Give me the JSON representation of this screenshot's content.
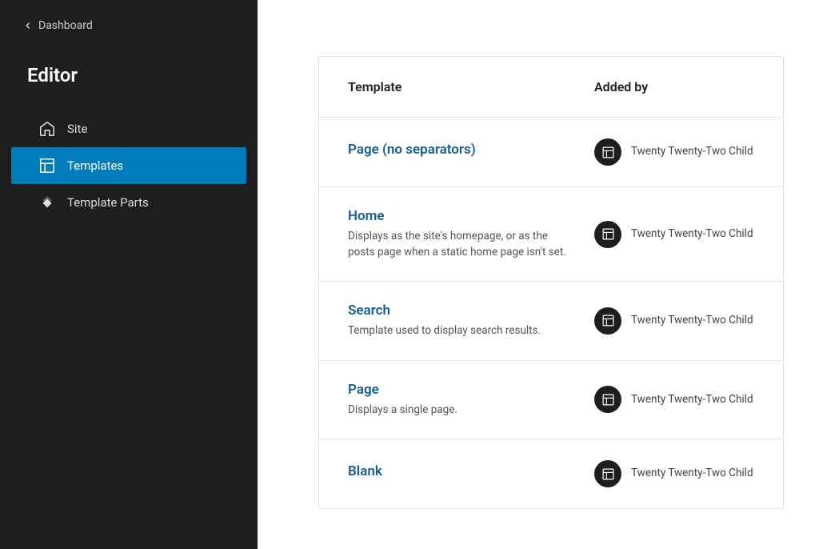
{
  "sidebar": {
    "back_label": "Dashboard",
    "title": "Editor",
    "items": [
      {
        "label": "Site",
        "active": false
      },
      {
        "label": "Templates",
        "active": true
      },
      {
        "label": "Template Parts",
        "active": false
      }
    ]
  },
  "table": {
    "headers": {
      "template": "Template",
      "added_by": "Added by"
    },
    "rows": [
      {
        "title": "Page (no separators)",
        "desc": "",
        "added_by": "Twenty Twenty-Two Child"
      },
      {
        "title": "Home",
        "desc": "Displays as the site's homepage, or as the posts page when a static home page isn't set.",
        "added_by": "Twenty Twenty-Two Child"
      },
      {
        "title": "Search",
        "desc": "Template used to display search results.",
        "added_by": "Twenty Twenty-Two Child"
      },
      {
        "title": "Page",
        "desc": "Displays a single page.",
        "added_by": "Twenty Twenty-Two Child"
      },
      {
        "title": "Blank",
        "desc": "",
        "added_by": "Twenty Twenty-Two Child"
      }
    ]
  }
}
